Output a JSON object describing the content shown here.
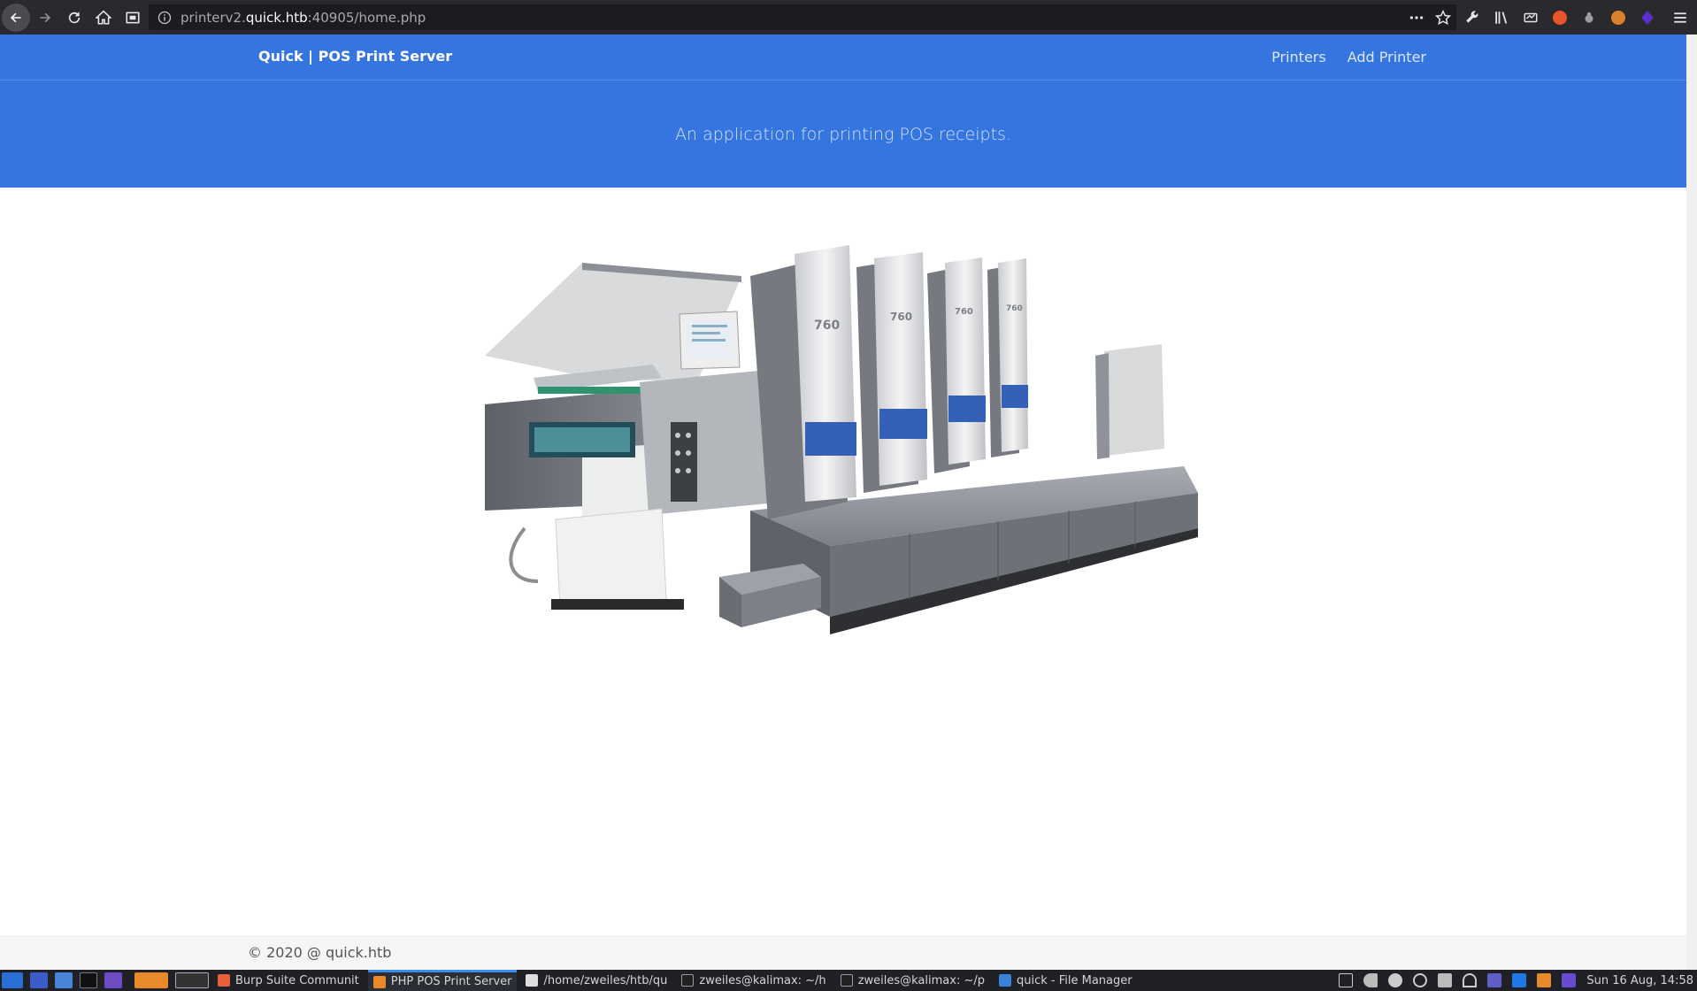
{
  "browser": {
    "url_prefix": "printerv2.",
    "url_host": "quick.htb",
    "url_suffix": ":40905/home.php"
  },
  "navbar": {
    "brand": "Quick | POS Print Server",
    "links": [
      "Printers",
      "Add Printer"
    ]
  },
  "hero": {
    "tagline": "An application for printing POS receipts."
  },
  "main_image": {
    "icon": "offset-printing-press-image",
    "label_text": "760"
  },
  "footer": {
    "copyright": "© 2020 @ quick.htb"
  },
  "taskbar": {
    "tasks": [
      {
        "label": "Burp Suite Communit",
        "active": false
      },
      {
        "label": "PHP POS Print Server",
        "active": true
      },
      {
        "label": "/home/zweiles/htb/qu",
        "active": false
      },
      {
        "label": "zweiles@kalimax: ~/h",
        "active": false
      },
      {
        "label": "zweiles@kalimax: ~/p",
        "active": false
      },
      {
        "label": "quick - File Manager",
        "active": false
      }
    ],
    "clock": "Sun 16 Aug, 14:58"
  },
  "colors": {
    "navbar_bg": "#3575e0",
    "footer_bg": "#f5f5f5"
  }
}
